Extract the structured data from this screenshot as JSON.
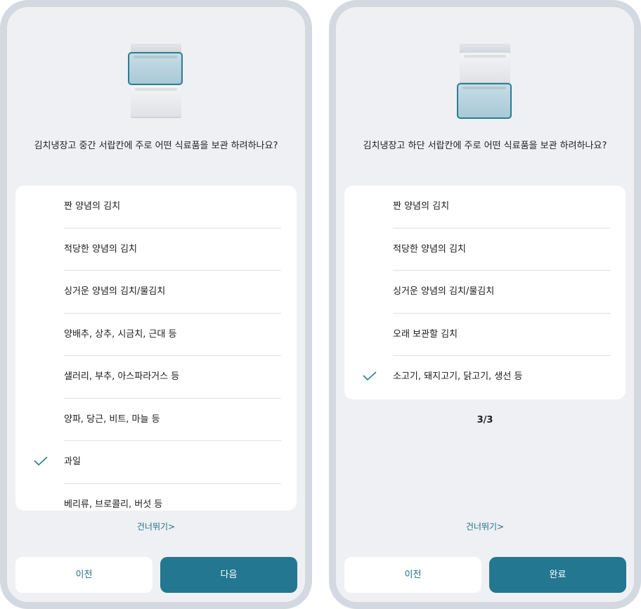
{
  "screens": [
    {
      "question": "김치냉장고 중간 서랍칸에 주로 어떤 식료품을 보관 하려하나요?",
      "options": [
        {
          "label": "짠 양념의 김치",
          "checked": false
        },
        {
          "label": "적당한 양념의 김치",
          "checked": false
        },
        {
          "label": "싱거운 양념의 김치/물김치",
          "checked": false
        },
        {
          "label": "양배추, 상추, 시금치, 근대 등",
          "checked": false
        },
        {
          "label": "샐러리, 부추, 아스파라거스 등",
          "checked": false
        },
        {
          "label": "양파, 당근, 비트, 마늘 등",
          "checked": false
        },
        {
          "label": "과일",
          "checked": true
        },
        {
          "label": "베리류, 브로콜리, 버섯 등",
          "checked": false
        }
      ],
      "skip_label": "건너뛰기>",
      "prev_label": "이전",
      "next_label": "다음"
    },
    {
      "question": "김치냉장고 하단 서랍칸에 주로 어떤 식료품을 보관 하려하나요?",
      "options": [
        {
          "label": "짠 양념의 김치",
          "checked": false
        },
        {
          "label": "적당한 양념의 김치",
          "checked": false
        },
        {
          "label": "싱거운 양념의 김치/물김치",
          "checked": false
        },
        {
          "label": "오래 보관할 김치",
          "checked": false
        },
        {
          "label": "소고기, 돼지고기, 닭고기, 생선 등",
          "checked": true
        }
      ],
      "page_indicator": "3/3",
      "skip_label": "건너뛰기>",
      "prev_label": "이전",
      "next_label": "완료"
    }
  ],
  "colors": {
    "accent": "#237790",
    "accent_text": "#1f6f84",
    "background": "#eef0f4",
    "card": "#ffffff",
    "selected_drawer_border": "#2b7d91"
  },
  "icons": {
    "check": "check-icon",
    "fridge": "kimchi-fridge-icon"
  }
}
